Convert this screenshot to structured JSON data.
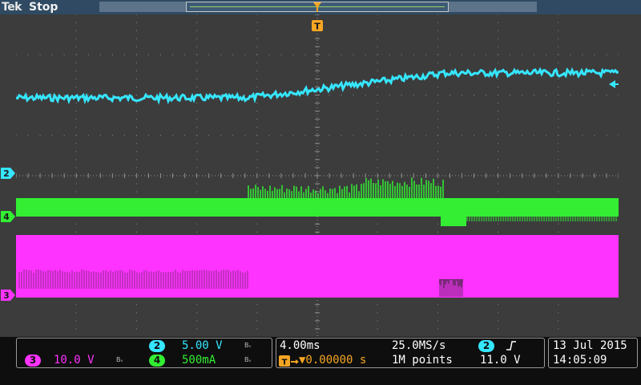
{
  "header": {
    "brand": "Tek",
    "run_state": "Stop"
  },
  "colors": {
    "ch2": "#35e6ff",
    "ch3": "#ff33ff",
    "ch4": "#33ee33",
    "trigger": "#f5a623",
    "grid": "#8f8f8f"
  },
  "markers": {
    "ch2": "2",
    "ch4": "4",
    "ch3": "3",
    "trigger_top": "T"
  },
  "icons": {
    "trigger_position": "trigger-t-icon",
    "trigger_slope": "rising-edge-icon"
  },
  "channels": {
    "ch2": {
      "number": "2",
      "scale": "5.00 V",
      "bw": "Bᵥ"
    },
    "ch3": {
      "number": "3",
      "scale": "10.0 V",
      "bw": "Bᵥ"
    },
    "ch4": {
      "number": "4",
      "scale": "500mA",
      "bw": "Bᵥ"
    }
  },
  "horizontal": {
    "time_div": "4.00ms",
    "sample_rate": "25.0MS/s",
    "delay": "▼0.00000 s",
    "record_length": "1M points"
  },
  "trigger": {
    "source": "2",
    "slope": "ʃ",
    "level": "11.0 V"
  },
  "datetime": {
    "date": "13 Jul  2015",
    "time": "14:05:09"
  }
}
